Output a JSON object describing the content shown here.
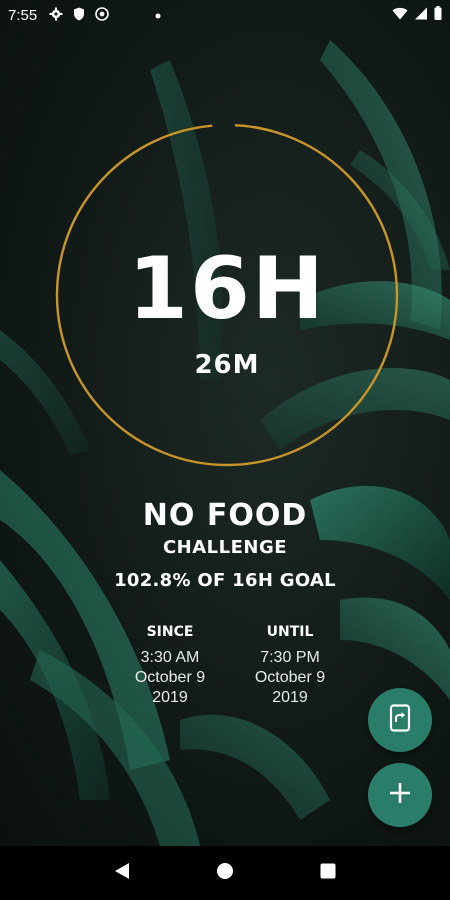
{
  "status_bar": {
    "time": "7:55",
    "left_icons": [
      "settings-icon",
      "shield-icon",
      "at-sign-icon",
      "dot-icon"
    ],
    "right_icons": [
      "wifi-icon",
      "signal-icon",
      "battery-icon"
    ]
  },
  "timer": {
    "hours": "16H",
    "minutes": "26M",
    "progress_percent": 102.8,
    "ring_color": "#c8952a"
  },
  "challenge": {
    "title": "NO FOOD",
    "subtitle": "CHALLENGE",
    "goal_text": "102.8% OF 16H GOAL"
  },
  "since": {
    "label": "SINCE",
    "time": "3:30 AM",
    "date": "October 9",
    "year": "2019"
  },
  "until": {
    "label": "UNTIL",
    "time": "7:30 PM",
    "date": "October 9",
    "year": "2019"
  },
  "fabs": {
    "share_icon": "share-screen-icon",
    "add_icon": "plus-icon",
    "color": "#2a7d68"
  },
  "nav_bar": {
    "icons": [
      "back-icon",
      "home-icon",
      "recents-icon"
    ]
  }
}
